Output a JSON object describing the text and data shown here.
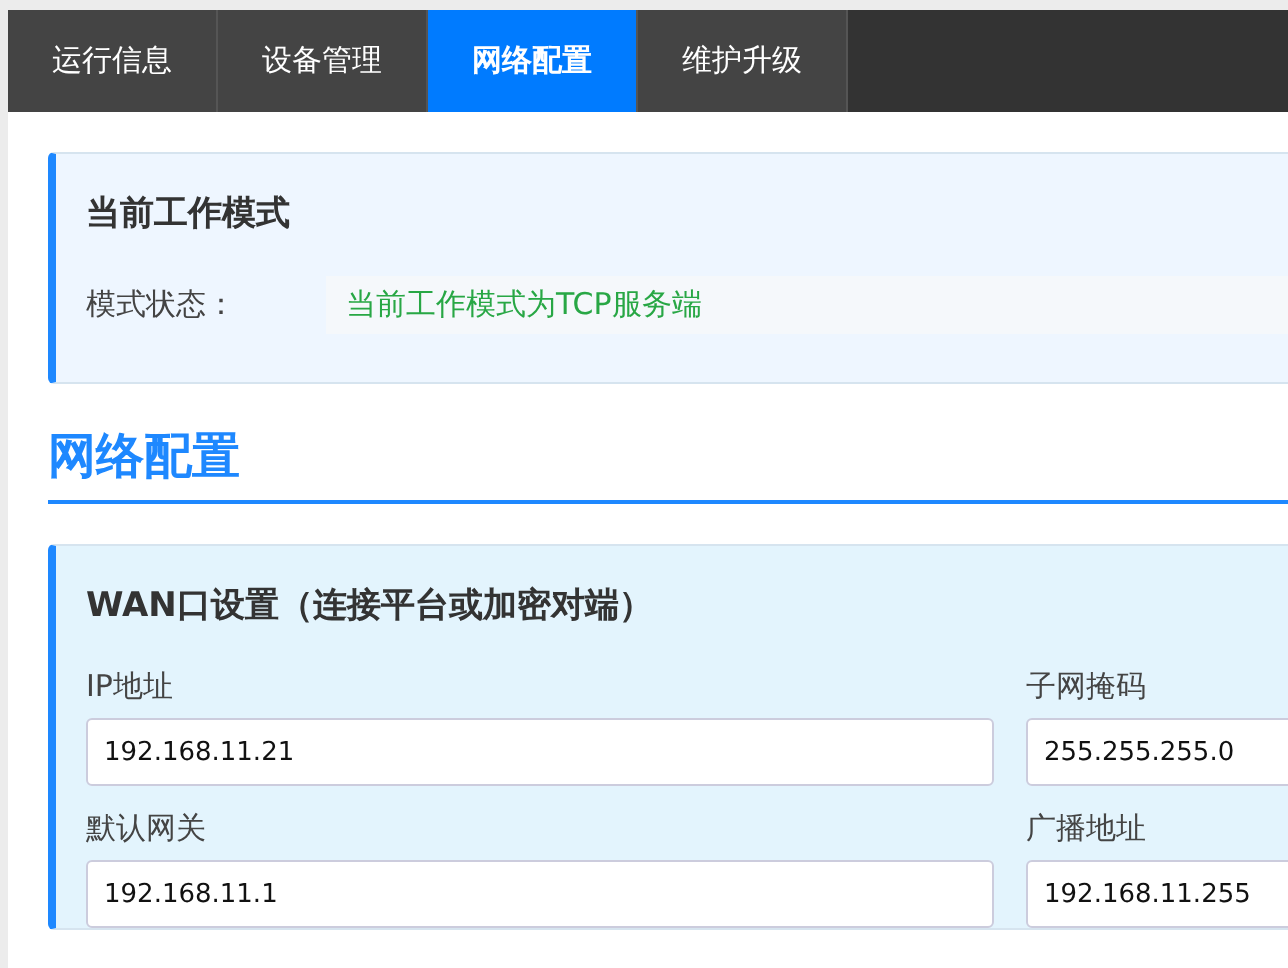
{
  "tabs": [
    {
      "label": "运行信息",
      "selected": false
    },
    {
      "label": "设备管理",
      "selected": false
    },
    {
      "label": "网络配置",
      "selected": true
    },
    {
      "label": "维护升级",
      "selected": false
    }
  ],
  "mode_card": {
    "title": "当前工作模式",
    "label": "模式状态：",
    "value": "当前工作模式为TCP服务端"
  },
  "section_title": "网络配置",
  "wan_card": {
    "title": "WAN口设置（连接平台或加密对端）",
    "fields": [
      {
        "label": "IP地址",
        "value": "192.168.11.21"
      },
      {
        "label": "子网掩码",
        "value": "255.255.255.0"
      },
      {
        "label": "默认网关",
        "value": "192.168.11.1"
      },
      {
        "label": "广播地址",
        "value": "192.168.11.255"
      }
    ]
  }
}
